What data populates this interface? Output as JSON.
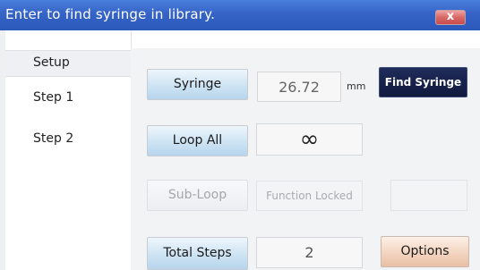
{
  "window": {
    "title": "Enter to find syringe in library.",
    "close_label": "x"
  },
  "sidebar": {
    "items": [
      {
        "label": "Setup",
        "selected": true
      },
      {
        "label": "Step 1",
        "selected": false
      },
      {
        "label": "Step 2",
        "selected": false
      }
    ]
  },
  "panel": {
    "syringe": {
      "button_label": "Syringe",
      "value": "26.72",
      "unit": "mm",
      "find_button_label": "Find Syringe"
    },
    "loop_all": {
      "button_label": "Loop All",
      "value": "∞"
    },
    "sub_loop": {
      "button_label": "Sub-Loop",
      "status": "Function Locked",
      "enabled": false
    },
    "total_steps": {
      "button_label": "Total Steps",
      "value": "2"
    },
    "options_label": "Options"
  },
  "colors": {
    "titlebar": "#3563c6",
    "find_button": "#111a3e",
    "options_button": "#f2d2bd",
    "primary_button": "#cde3f3"
  }
}
